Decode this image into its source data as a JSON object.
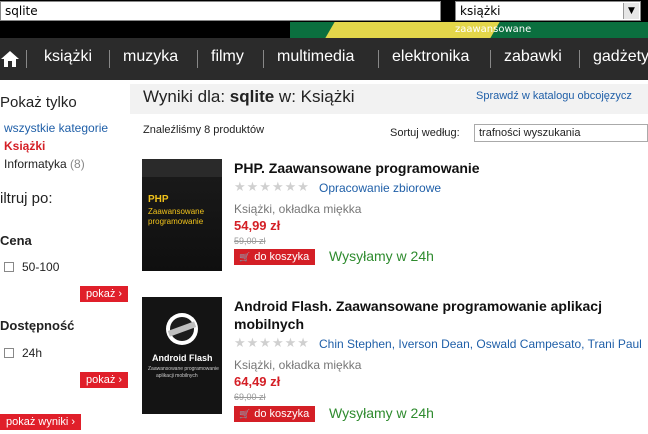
{
  "search": {
    "value": "sqlite"
  },
  "category_select": {
    "value": "książki",
    "advanced_label": "zaawansowane"
  },
  "nav": {
    "items": [
      "książki",
      "muzyka",
      "filmy",
      "multimedia",
      "elektronika",
      "zabawki",
      "gadżety"
    ]
  },
  "sidebar": {
    "show_only": "Pokaż tylko",
    "all_categories": "wszystkie kategorie",
    "active_category": "Książki",
    "subcategory": "Informatyka",
    "subcategory_count": "(8)",
    "filter_heading": "iltruj po:",
    "price_heading": "Cena",
    "price_option": "50-100",
    "show_button_1": "pokaż ›",
    "availability_heading": "Dostępność",
    "availability_option": "24h",
    "show_button_2": "pokaż ›",
    "show_results_button": "pokaż wyniki ›"
  },
  "results": {
    "label": "Wyniki dla:",
    "query": "sqlite",
    "in_label": "w: Książki",
    "check_catalog": "Sprawdź w katalogu obcojęzycz",
    "found": "Znaleźliśmy 8 produktów",
    "sort_label": "Sortuj według:",
    "sort_value": "trafności wyszukania"
  },
  "products": [
    {
      "title": "PHP. Zaawansowane programowanie",
      "author": "Opracowanie zbiorowe",
      "binding": "Książki, okładka miękka",
      "price": "54,99 zł",
      "old_price": "59,00 zł",
      "cart": "do koszyka",
      "shipping": "Wysyłamy w 24h",
      "cover_title": "PHP",
      "cover_sub1": "Zaawansowane",
      "cover_sub2": "programowanie"
    },
    {
      "title_line1": "Android Flash. Zaawansowane programowanie aplikacj",
      "title_line2": "mobilnych",
      "authors": "Chin Stephen, Iverson Dean, Oswald Campesato, Trani Paul",
      "binding": "Książki, okładka miękka",
      "price": "64,49 zł",
      "old_price": "69,00 zł",
      "cart": "do koszyka",
      "shipping": "Wysyłamy w 24h",
      "cover_title": "Android Flash",
      "cover_sub1": "Zaawansowane programowanie",
      "cover_sub2": "aplikacji mobilnych"
    }
  ],
  "colors": {
    "accent_red": "#d41f26",
    "link_blue": "#1f5fa8",
    "ship_green": "#2e8b2e",
    "nav_bg": "#2b2b2b"
  }
}
